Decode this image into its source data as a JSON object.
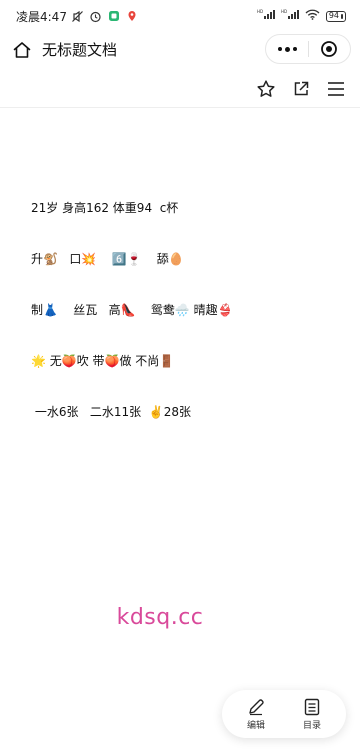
{
  "status_bar": {
    "time": "凌晨4:47",
    "signal_1": "HD",
    "signal_2": "HD",
    "battery": "94"
  },
  "title_bar": {
    "title": "无标题文档"
  },
  "document": {
    "lines": [
      "21岁 身高162 体重94  c杯",
      "升🐒   口💥    6️⃣🍷    舔🥚",
      "制👗    丝瓦   高👠    鸳鸯🌧️ 晴趣👙",
      "🌟 无🍑吹 带🍑做 不尚🚪",
      " 一水6张   二水11张  ✌️28张"
    ]
  },
  "watermark": "kdsq.cc",
  "bottom_bar": {
    "edit_label": "编辑",
    "toc_label": "目录"
  },
  "icons": {
    "home": "home-icon",
    "more": "more-dots-icon",
    "close": "target-close-icon",
    "star": "star-icon",
    "share": "share-external-icon",
    "menu": "menu-icon",
    "edit": "pencil-icon",
    "toc": "list-icon"
  },
  "colors": {
    "watermark": "#d9499a",
    "background": "#ffffff",
    "text": "#111111"
  }
}
